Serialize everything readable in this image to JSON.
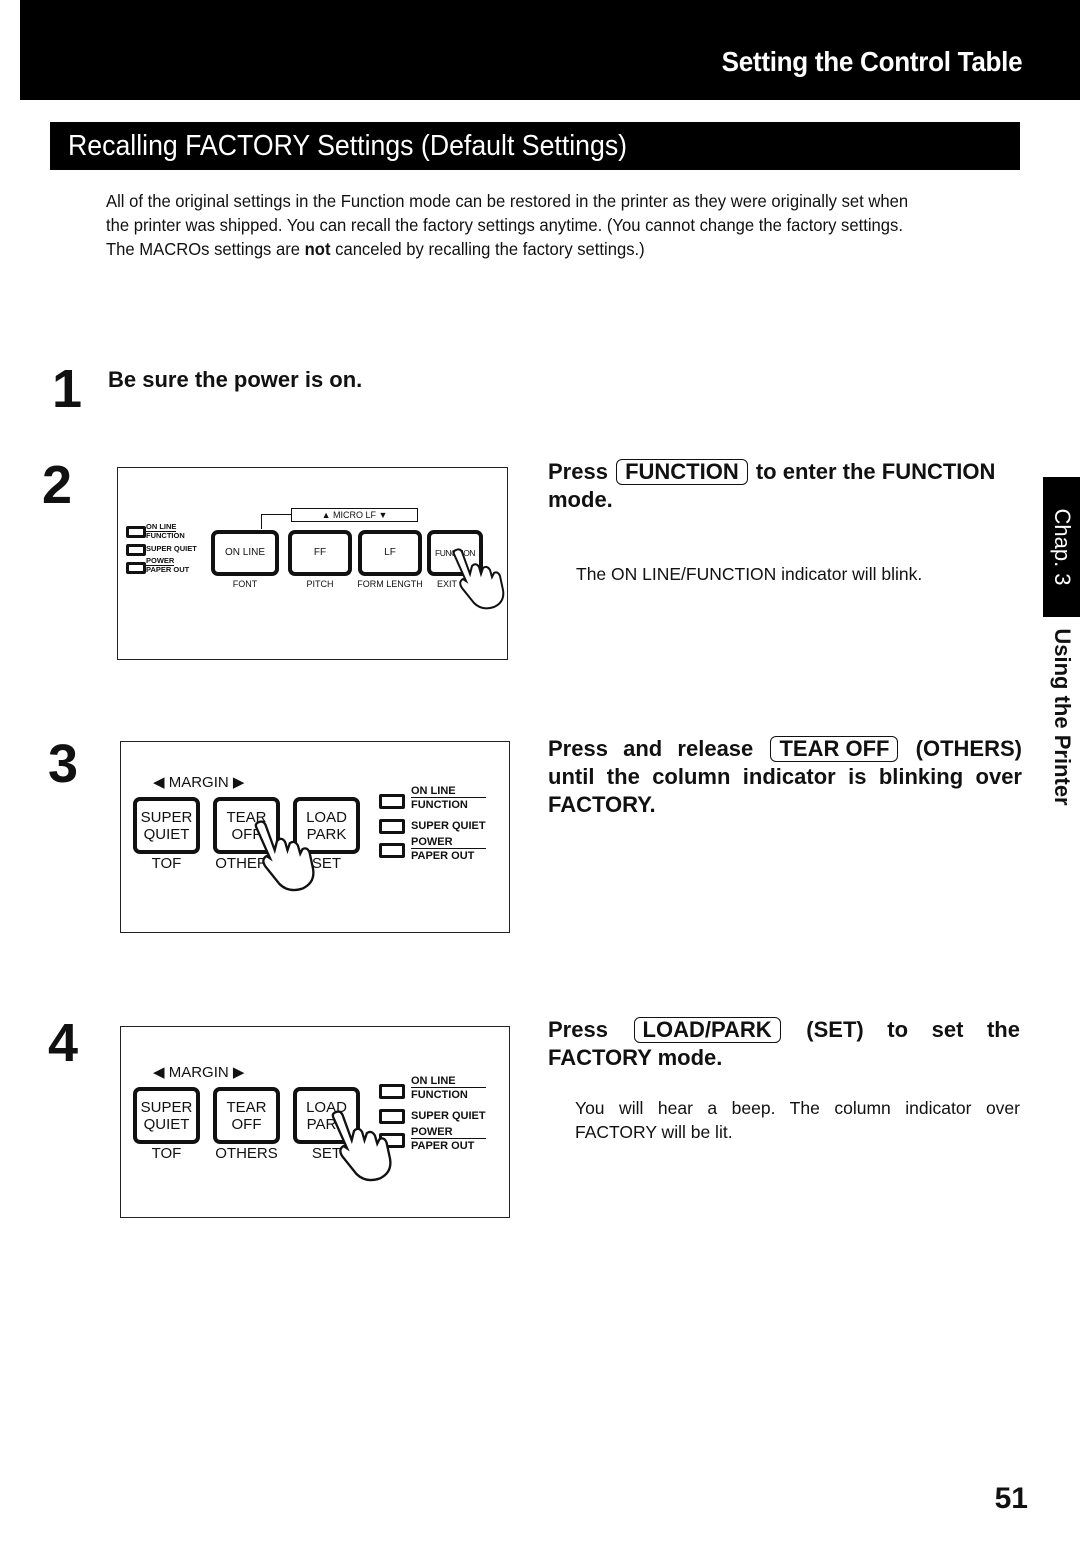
{
  "header": {
    "chapter_title": "Setting the Control Table",
    "section_title": "Recalling FACTORY Settings (Default Settings)"
  },
  "intro": {
    "text_before_bold": "All of the original settings in the Function mode can be restored in the printer as they were originally set when the printer was shipped. You can recall the factory settings anytime. (You cannot change the factory settings. The MACROs settings are ",
    "bold_word": "not",
    "text_after_bold": " canceled by recalling the factory settings.)"
  },
  "steps": [
    {
      "number": "1",
      "title": "Be sure the power is on."
    },
    {
      "number": "2",
      "title_prefix": "Press",
      "key": "FUNCTION",
      "title_suffix": "to enter the FUNCTION mode.",
      "description": "The ON LINE/FUNCTION indicator will blink."
    },
    {
      "number": "3",
      "title_prefix": "Press and release",
      "key": "TEAR OFF",
      "title_suffix": "(OTHERS) until the column indicator is blinking over FACTORY."
    },
    {
      "number": "4",
      "title_prefix": "Press",
      "key": "LOAD/PARK",
      "title_suffix": "(SET) to set the FACTORY mode.",
      "description": "You will hear a beep. The column indicator over FACTORY will be lit."
    }
  ],
  "diagram_step2": {
    "micro_lf": "▲ MICRO LF ▼",
    "indicators": [
      "ON LINE",
      "FUNCTION",
      "SUPER QUIET",
      "POWER",
      "PAPER OUT"
    ],
    "keys": [
      {
        "label": "ON LINE",
        "sub": "FONT"
      },
      {
        "label": "FF",
        "sub": "PITCH"
      },
      {
        "label": "LF",
        "sub": "FORM LENGTH"
      },
      {
        "label": "FUNCTION",
        "sub": "EXIT"
      }
    ]
  },
  "diagram_step3": {
    "margin": "◀ MARGIN ▶",
    "keys": [
      {
        "line1": "SUPER",
        "line2": "QUIET",
        "sub": "TOF"
      },
      {
        "line1": "TEAR",
        "line2": "OFF",
        "sub": "OTHERS"
      },
      {
        "line1": "LOAD",
        "line2": "PARK",
        "sub": "SET"
      }
    ],
    "indicators": [
      "ON LINE",
      "FUNCTION",
      "SUPER QUIET",
      "POWER",
      "PAPER OUT"
    ]
  },
  "diagram_step4": {
    "margin": "◀ MARGIN ▶",
    "keys": [
      {
        "line1": "SUPER",
        "line2": "QUIET",
        "sub": "TOF"
      },
      {
        "line1": "TEAR",
        "line2": "OFF",
        "sub": "OTHERS"
      },
      {
        "line1": "LOAD",
        "line2": "PARK",
        "sub": "SET"
      }
    ],
    "indicators": [
      "ON LINE",
      "FUNCTION",
      "SUPER QUIET",
      "POWER",
      "PAPER OUT"
    ]
  },
  "side_tab": {
    "chapter": "Chap. 3",
    "title": "Using the Printer"
  },
  "page_number": "51"
}
